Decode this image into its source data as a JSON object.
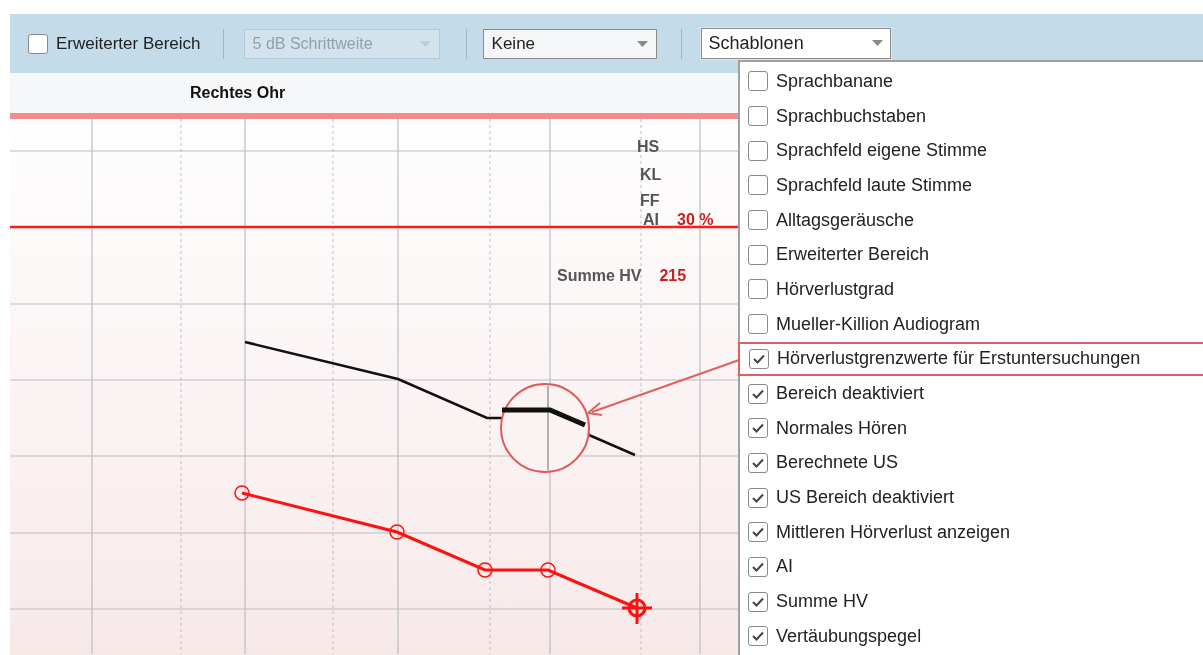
{
  "toolbar": {
    "extended_range": {
      "label": "Erweiterter Bereich",
      "checked": false
    },
    "step_dropdown": {
      "value": "5 dB Schrittweite",
      "disabled": true
    },
    "masking_dropdown": {
      "value": "Keine",
      "disabled": false
    },
    "templates_dropdown": {
      "value": "Schablonen",
      "expanded": true
    }
  },
  "chart_header": {
    "title": "Rechtes Ohr"
  },
  "chart_labels": [
    {
      "label": "HS"
    },
    {
      "label": "KL"
    },
    {
      "label": "FF"
    },
    {
      "label": "AI",
      "value": "30 %"
    },
    {
      "label": "Summe HV",
      "value": "215"
    }
  ],
  "templates_menu": [
    {
      "label": "Sprachbanane",
      "checked": false,
      "highlighted": false
    },
    {
      "label": "Sprachbuchstaben",
      "checked": false,
      "highlighted": false
    },
    {
      "label": "Sprachfeld eigene Stimme",
      "checked": false,
      "highlighted": false
    },
    {
      "label": "Sprachfeld laute Stimme",
      "checked": false,
      "highlighted": false
    },
    {
      "label": "Alltagsgeräusche",
      "checked": false,
      "highlighted": false
    },
    {
      "label": "Erweiterter Bereich",
      "checked": false,
      "highlighted": false
    },
    {
      "label": "Hörverlustgrad",
      "checked": false,
      "highlighted": false
    },
    {
      "label": "Mueller-Killion Audiogram",
      "checked": false,
      "highlighted": false
    },
    {
      "label": "Hörverlustgrenzwerte für Erstuntersuchungen",
      "checked": true,
      "highlighted": true
    },
    {
      "label": "Bereich deaktiviert",
      "checked": true,
      "highlighted": false
    },
    {
      "label": "Normales Hören",
      "checked": true,
      "highlighted": false
    },
    {
      "label": "Berechnete US",
      "checked": true,
      "highlighted": false
    },
    {
      "label": "US Bereich deaktiviert",
      "checked": true,
      "highlighted": false
    },
    {
      "label": "Mittleren Hörverlust anzeigen",
      "checked": true,
      "highlighted": false
    },
    {
      "label": "AI",
      "checked": true,
      "highlighted": false
    },
    {
      "label": "Summe HV",
      "checked": true,
      "highlighted": false
    },
    {
      "label": "Vertäubungspegel",
      "checked": true,
      "highlighted": false
    }
  ]
}
